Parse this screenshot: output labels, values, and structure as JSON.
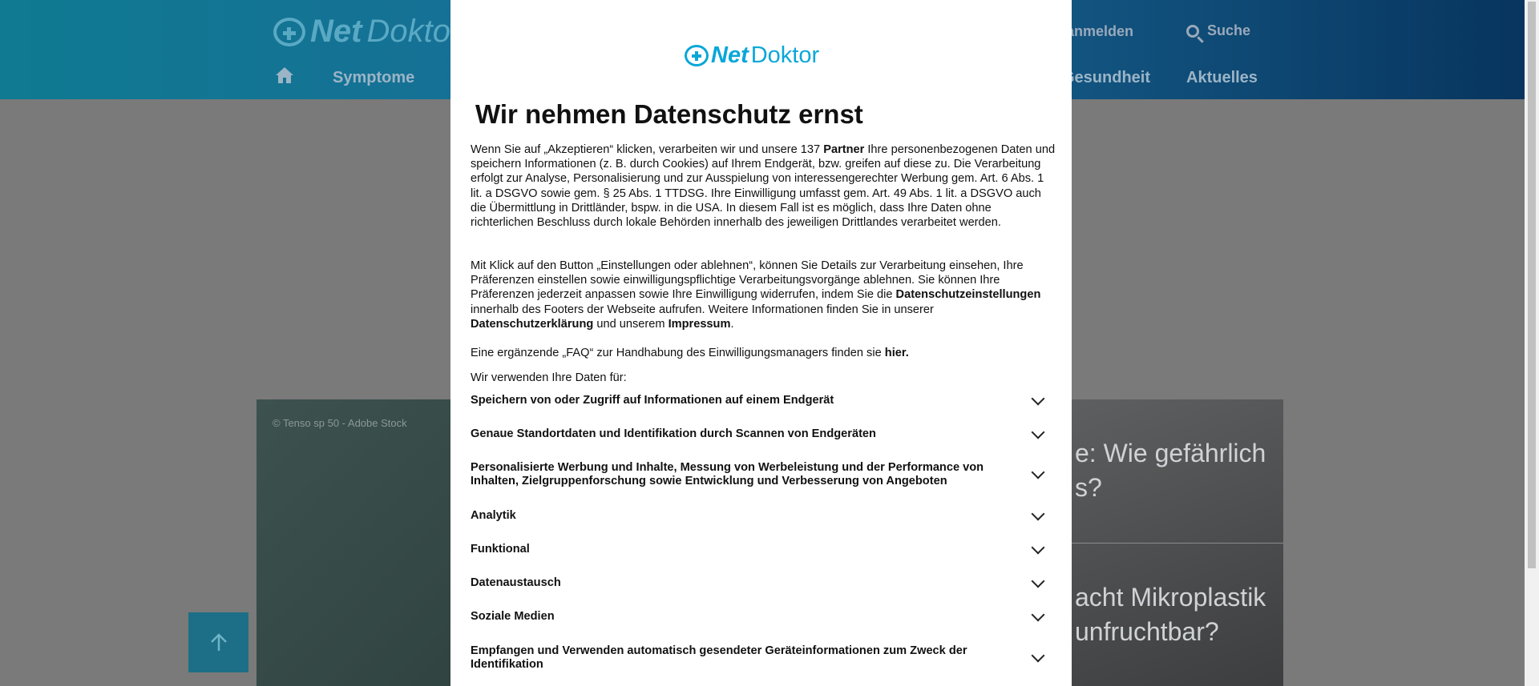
{
  "site": {
    "logo_bold": "Net",
    "logo_rest": "Doktor",
    "nav": [
      "Symptome",
      "Gesundheit",
      "Aktuelles"
    ],
    "login": "er anmelden",
    "search": "Suche",
    "hero_credit": "© Tenso sp 50 - Adobe Stock",
    "teaser1": [
      "e: Wie gefährlich",
      "s?"
    ],
    "teaser2": [
      "acht Mikroplastik",
      "unfruchtbar?"
    ]
  },
  "modal": {
    "logo_bold": "Net",
    "logo_rest": "Doktor",
    "title": "Wir nehmen Datenschutz ernst",
    "p1_a": "Wenn Sie auf „Akzeptieren“ klicken, verarbeiten wir und unsere 137 ",
    "p1_b": "Partner",
    "p1_c": " Ihre personenbezogenen Daten und speichern Informationen (z. B. durch Cookies) auf Ihrem Endgerät, bzw. greifen auf diese zu. Die Verarbeitung erfolgt zur Analyse, Personalisierung und zur Ausspielung von interessengerechter Werbung gem. Art. 6 Abs. 1 lit. a DSGVO sowie gem. § 25 Abs. 1 TTDSG. Ihre Einwilligung umfasst gem. Art. 49 Abs. 1 lit. a DSGVO auch die Übermittlung in Drittländer, bspw. in die USA. In diesem Fall ist es möglich, dass Ihre Daten ohne richterlichen Beschluss durch lokale Behörden innerhalb des jeweiligen Drittlandes verarbeitet werden.",
    "p2_a": "Mit Klick auf den Button „Einstellungen oder ablehnen“, können Sie Details zur Verarbeitung einsehen, Ihre Präferenzen einstellen sowie einwilligungspflichtige Verarbeitungsvorgänge ablehnen. Sie können Ihre Präferenzen jederzeit anpassen sowie Ihre Einwilligung widerrufen, indem Sie die ",
    "p2_b": "Datenschutzeinstellungen",
    "p2_c": " innerhalb des Footers der Webseite aufrufen. Weitere Informationen finden Sie in unserer ",
    "p2_d": "Datenschutzerklärung",
    "p2_e": " und unserem ",
    "p2_f": "Impressum",
    "p2_g": ".",
    "p3_a": "Eine ergänzende „FAQ“ zur Handhabung des Einwilligungsmanagers finden sie ",
    "p3_b": "hier.",
    "p4": "Wir verwenden Ihre Daten für:",
    "purposes": [
      "Speichern von oder Zugriff auf Informationen auf einem Endgerät",
      "Genaue Standortdaten und Identifikation durch Scannen von Endgeräten",
      "Personalisierte Werbung und Inhalte, Messung von Werbeleistung und der Performance von Inhalten, Zielgruppenforschung sowie Entwicklung und Verbesserung von Angeboten",
      "Analytik",
      "Funktional",
      "Datenaustausch",
      "Soziale Medien",
      "Empfangen und Verwenden automatisch gesendeter Geräteinformationen zum Zweck der Identifikation"
    ]
  }
}
